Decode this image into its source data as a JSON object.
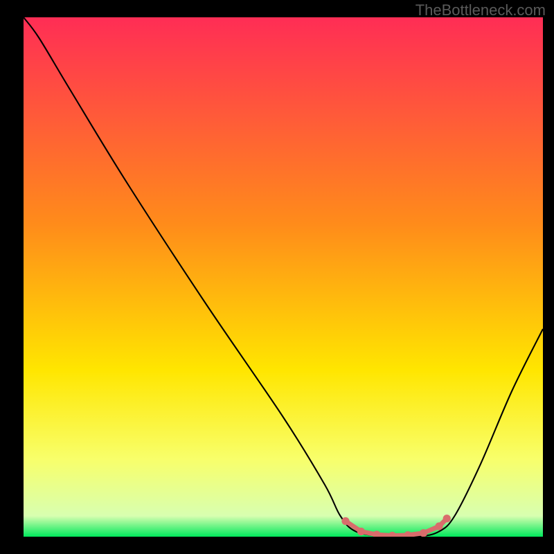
{
  "watermark": "TheBottleneck.com",
  "chart_data": {
    "type": "line",
    "title": "",
    "xlabel": "",
    "ylabel": "",
    "xlim": [
      0,
      100
    ],
    "ylim": [
      0,
      100
    ],
    "gradient_stops": [
      {
        "offset": 0,
        "color": "#ff2d55"
      },
      {
        "offset": 40,
        "color": "#ff8c1a"
      },
      {
        "offset": 68,
        "color": "#ffe600"
      },
      {
        "offset": 85,
        "color": "#f8ff6a"
      },
      {
        "offset": 96,
        "color": "#d8ffb0"
      },
      {
        "offset": 100,
        "color": "#00e85c"
      }
    ],
    "curve_points": [
      {
        "x": 0,
        "y": 100
      },
      {
        "x": 3,
        "y": 96
      },
      {
        "x": 9,
        "y": 86
      },
      {
        "x": 20,
        "y": 68
      },
      {
        "x": 35,
        "y": 45
      },
      {
        "x": 50,
        "y": 23
      },
      {
        "x": 58,
        "y": 10
      },
      {
        "x": 61,
        "y": 4
      },
      {
        "x": 64,
        "y": 1
      },
      {
        "x": 70,
        "y": 0
      },
      {
        "x": 76,
        "y": 0
      },
      {
        "x": 80,
        "y": 1
      },
      {
        "x": 83,
        "y": 4
      },
      {
        "x": 88,
        "y": 14
      },
      {
        "x": 94,
        "y": 28
      },
      {
        "x": 100,
        "y": 40
      }
    ],
    "flat_markers": {
      "color": "#d96c6c",
      "points": [
        {
          "x": 62,
          "y": 3.0
        },
        {
          "x": 65,
          "y": 1.0
        },
        {
          "x": 68,
          "y": 0.4
        },
        {
          "x": 71,
          "y": 0.2
        },
        {
          "x": 74,
          "y": 0.3
        },
        {
          "x": 77,
          "y": 0.7
        },
        {
          "x": 80,
          "y": 2.0
        },
        {
          "x": 81.5,
          "y": 3.5
        }
      ]
    }
  }
}
